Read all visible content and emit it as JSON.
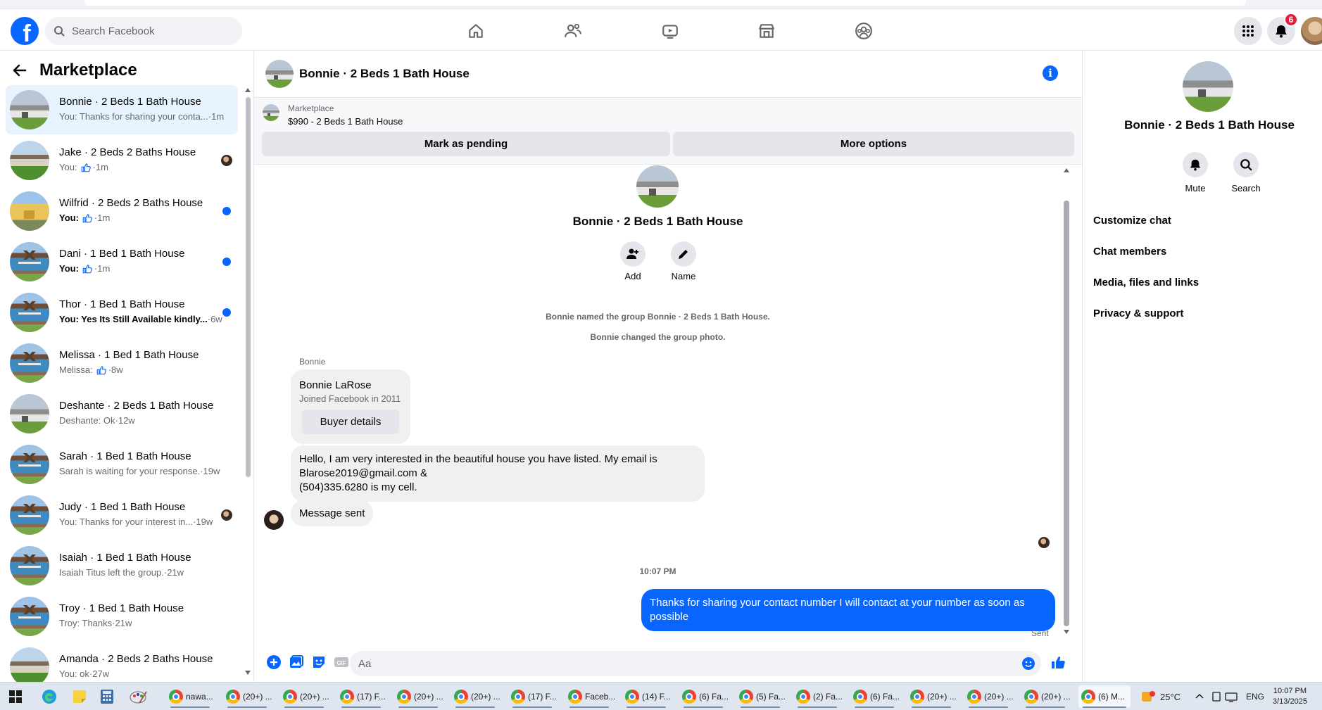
{
  "app": {
    "search_placeholder": "Search Facebook",
    "notification_count": "6",
    "logo_letter": "f"
  },
  "nav": {
    "icons": [
      "home-icon",
      "friends-icon",
      "watch-icon",
      "marketplace-icon",
      "groups-icon"
    ]
  },
  "sidebar": {
    "title": "Marketplace",
    "conversations": [
      {
        "name": "Bonnie · 2 Beds 1 Bath House",
        "preview": "You: Thanks for sharing your conta...",
        "time": "1m",
        "thumb": "gray",
        "active": true,
        "unread": false,
        "status": "none"
      },
      {
        "name": "Jake · 2 Beds 2 Baths House",
        "preview": "You:",
        "time": "1m",
        "thumb": "green",
        "active": false,
        "unread": false,
        "like": true,
        "status": "seen"
      },
      {
        "name": "Wilfrid · 2 Beds 2 Baths House",
        "preview": "You:",
        "time": "1m",
        "thumb": "yellow",
        "active": false,
        "unread": true,
        "like": true,
        "status": "dot"
      },
      {
        "name": "Dani · 1 Bed 1 Bath House",
        "preview": "You:",
        "time": "1m",
        "thumb": "blue",
        "active": false,
        "unread": true,
        "like": true,
        "status": "dot"
      },
      {
        "name": "Thor · 1 Bed 1 Bath House",
        "preview": "You: Yes Its Still Available kindly...",
        "time": "6w",
        "thumb": "blue",
        "active": false,
        "unread": true,
        "status": "dot"
      },
      {
        "name": "Melissa · 1 Bed 1 Bath House",
        "preview": "Melissa:",
        "time": "8w",
        "thumb": "blue",
        "active": false,
        "unread": false,
        "like": true,
        "status": "none"
      },
      {
        "name": "Deshante · 2 Beds 1 Bath House",
        "preview": "Deshante: Ok",
        "time": "12w",
        "thumb": "gray",
        "active": false,
        "unread": false,
        "status": "none"
      },
      {
        "name": "Sarah · 1 Bed 1 Bath House",
        "preview": "Sarah is waiting for your response.",
        "time": "19w",
        "thumb": "blue",
        "active": false,
        "unread": false,
        "status": "none"
      },
      {
        "name": "Judy · 1 Bed 1 Bath House",
        "preview": "You: Thanks for your interest in...",
        "time": "19w",
        "thumb": "blue",
        "active": false,
        "unread": false,
        "status": "seen"
      },
      {
        "name": "Isaiah · 1 Bed 1 Bath House",
        "preview": "Isaiah Titus left the group.",
        "time": "21w",
        "thumb": "blue",
        "active": false,
        "unread": false,
        "status": "none"
      },
      {
        "name": "Troy · 1 Bed 1 Bath House",
        "preview": "Troy: Thanks",
        "time": "21w",
        "thumb": "blue",
        "active": false,
        "unread": false,
        "status": "none"
      },
      {
        "name": "Amanda · 2 Beds 2 Baths House",
        "preview": "You: ok",
        "time": "27w",
        "thumb": "green",
        "active": false,
        "unread": false,
        "status": "none"
      }
    ]
  },
  "chat": {
    "title": "Bonnie · 2 Beds 1 Bath House",
    "listing_label": "Marketplace",
    "listing_price": "$990 - 2 Beds 1 Bath House",
    "mark_pending": "Mark as pending",
    "more_options": "More options",
    "group_name": "Bonnie · 2 Beds 1 Bath House",
    "add_label": "Add",
    "name_label": "Name",
    "system_messages": [
      "Bonnie named the group Bonnie · 2 Beds 1 Bath House.",
      "Bonnie changed the group photo."
    ],
    "sender": "Bonnie",
    "card_name": "Bonnie LaRose",
    "card_sub": "Joined Facebook in 2011",
    "buyer_details": "Buyer details",
    "incoming_lines": [
      "Hello, I am very interested in the beautiful house you have listed. My email is",
      "Blarose2019@gmail.com &",
      "(504)335.6280 is my cell."
    ],
    "incoming_2": "Message sent",
    "timestamp": "10:07 PM",
    "outgoing": "Thanks for sharing your contact number I will contact at your number as soon as possible",
    "sent_label": "Sent",
    "input_placeholder": "Aa"
  },
  "right_panel": {
    "name": "Bonnie · 2 Beds 1 Bath House",
    "mute": "Mute",
    "search": "Search",
    "sections": [
      "Customize chat",
      "Chat members",
      "Media, files and links",
      "Privacy & support"
    ]
  },
  "taskbar": {
    "items": [
      "nawa...",
      "(20+) ...",
      "(20+) ...",
      "(17) F...",
      "(20+) ...",
      "(20+) ...",
      "(17) F...",
      "Faceb...",
      "(14) F...",
      "(6) Fa...",
      "(5) Fa...",
      "(2) Fa...",
      "(6) Fa...",
      "(20+) ...",
      "(20+) ...",
      "(20+) ...",
      "(6) M..."
    ],
    "weather": "25°C",
    "lang": "ENG",
    "time": "10:07 PM",
    "date": "3/13/2025"
  },
  "colors": {
    "accent": "#0866ff",
    "active_row": "#e7f3ff",
    "badge": "#e41e3f"
  }
}
